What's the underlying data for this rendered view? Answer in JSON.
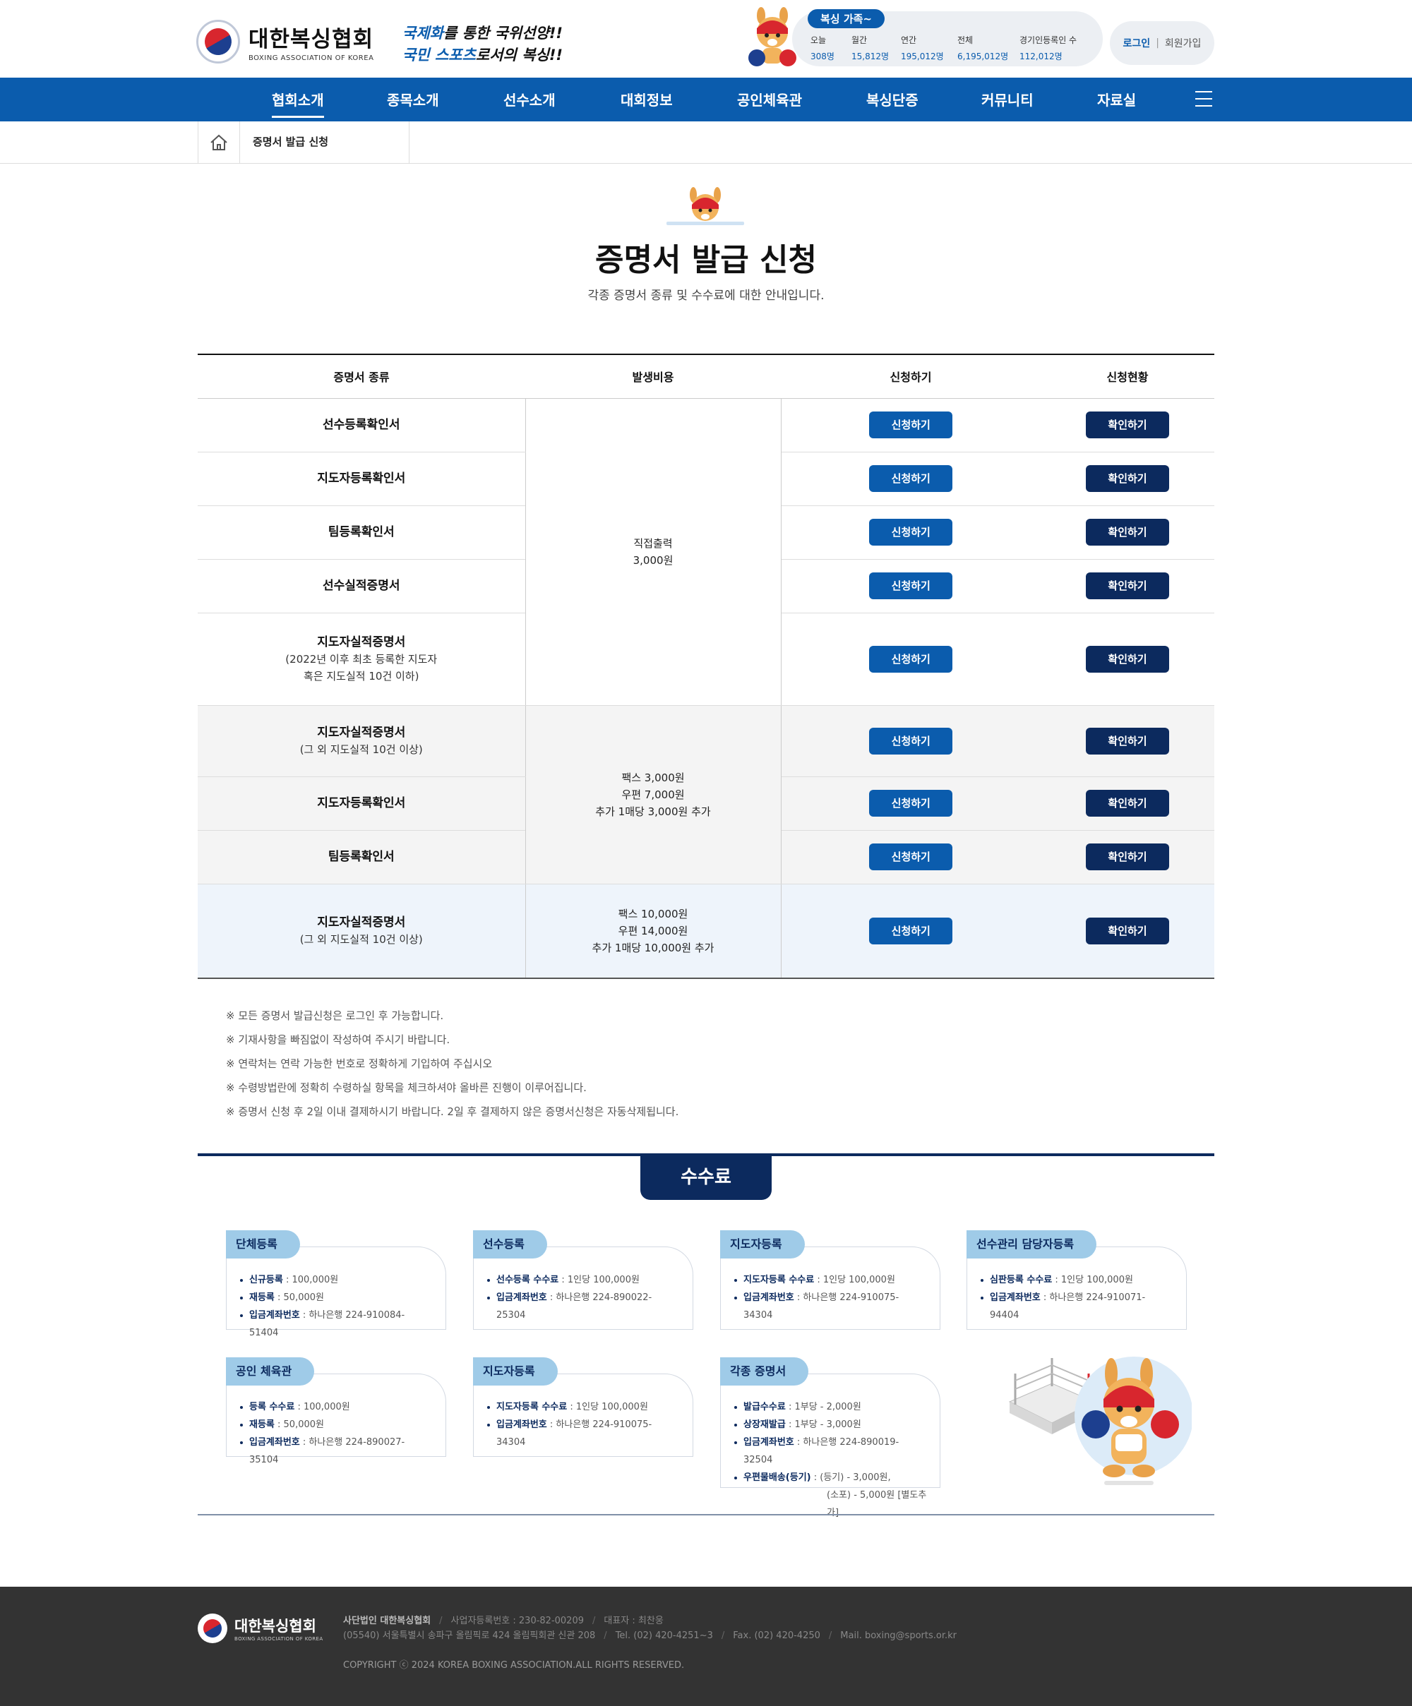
{
  "header": {
    "logo_kr": "대한복싱협회",
    "logo_en": "BOXING ASSOCIATION OF KOREA",
    "slogan_line1_hl": "국제화",
    "slogan_line1_rest": "를 통한 국위선양!!",
    "slogan_line2_hl": "국민 스포츠",
    "slogan_line2_rest": "로서의 복싱!!",
    "stats_badge": "복싱 가족~",
    "stats": [
      {
        "label": "오늘",
        "value": "308명"
      },
      {
        "label": "월간",
        "value": "15,812명"
      },
      {
        "label": "연간",
        "value": "195,012명"
      },
      {
        "label": "전체",
        "value": "6,195,012명"
      },
      {
        "label": "경기인등록인 수",
        "value": "112,012명"
      }
    ],
    "login": "로그인",
    "join": "회원가입"
  },
  "gnb": [
    "협회소개",
    "종목소개",
    "선수소개",
    "대회정보",
    "공인체육관",
    "복싱단증",
    "커뮤니티",
    "자료실"
  ],
  "breadcrumb": {
    "current": "증명서 발급 신청"
  },
  "page": {
    "title": "증명서 발급 신청",
    "subtitle": "각종 증명서 종류 및 수수료에 대한 안내입니다."
  },
  "table": {
    "headers": [
      "증명서 종류",
      "발생비용",
      "신청하기",
      "신청현황"
    ],
    "apply_label": "신청하기",
    "check_label": "확인하기",
    "group1": {
      "fee_lines": [
        "직접출력",
        "3,000원"
      ],
      "rows": [
        {
          "name": "선수등록확인서",
          "sub": []
        },
        {
          "name": "지도자등록확인서",
          "sub": []
        },
        {
          "name": "팀등록확인서",
          "sub": []
        },
        {
          "name": "선수실적증명서",
          "sub": []
        },
        {
          "name": "지도자실적증명서",
          "sub": [
            "(2022년 이후 최초 등록한 지도자",
            "혹은 지도실적 10건 이하)"
          ]
        }
      ]
    },
    "group2": {
      "fee_lines": [
        "팩스 3,000원",
        "우편 7,000원",
        "추가 1매당 3,000원 추가"
      ],
      "rows": [
        {
          "name": "지도자실적증명서",
          "sub": [
            "(그 외 지도실적 10건 이상)"
          ]
        },
        {
          "name": "지도자등록확인서",
          "sub": []
        },
        {
          "name": "팀등록확인서",
          "sub": []
        }
      ]
    },
    "group3": {
      "fee_lines": [
        "팩스 10,000원",
        "우편 14,000원",
        "추가 1매당 10,000원 추가"
      ],
      "rows": [
        {
          "name": "지도자실적증명서",
          "sub": [
            "(그 외 지도실적 10건 이상)"
          ]
        }
      ]
    }
  },
  "notes": [
    "※ 모든 증명서 발급신청은 로그인 후 가능합니다.",
    "※ 기재사항을 빠짐없이 작성하여 주시기 바랍니다.",
    "※ 연락처는 연락 가능한 번호로 정확하게 기입하여 주십시오",
    "※ 수령방법란에 정확히 수령하실 항목을 체크하셔야 올바른 진행이 이루어집니다.",
    "※ 증명서 신청 후 2일 이내 결제하시기 바랍니다. 2일 후 결제하지 않은 증명서신청은 자동삭제됩니다."
  ],
  "fees": {
    "tab": "수수료",
    "cards": [
      {
        "title": "단체등록",
        "items": [
          {
            "k": "신규등록",
            "v": " : 100,000원"
          },
          {
            "k": "재등록",
            "v": " : 50,000원"
          },
          {
            "k": "입금계좌번호",
            "v": " : 하나은행 224-910084-51404"
          }
        ]
      },
      {
        "title": "선수등록",
        "items": [
          {
            "k": "선수등록 수수료",
            "v": " : 1인당 100,000원"
          },
          {
            "k": "입금계좌번호",
            "v": " : 하나은행 224-890022-25304"
          }
        ]
      },
      {
        "title": "지도자등록",
        "items": [
          {
            "k": "지도자등록 수수료",
            "v": " : 1인당 100,000원"
          },
          {
            "k": "입금계좌번호",
            "v": " : 하나은행 224-910075-34304"
          }
        ]
      },
      {
        "title": "선수관리 담당자등록",
        "items": [
          {
            "k": "심판등록 수수료",
            "v": " : 1인당 100,000원"
          },
          {
            "k": "입금계좌번호",
            "v": " : 하나은행 224-910071-94404"
          }
        ]
      },
      {
        "title": "공인 체육관",
        "items": [
          {
            "k": "등록 수수료",
            "v": " : 100,000원"
          },
          {
            "k": "재등록",
            "v": " : 50,000원"
          },
          {
            "k": "입금계좌번호",
            "v": " : 하나은행 224-890027-35104"
          }
        ]
      },
      {
        "title": "지도자등록",
        "items": [
          {
            "k": "지도자등록 수수료",
            "v": " : 1인당 100,000원"
          },
          {
            "k": "입금계좌번호",
            "v": " : 하나은행 224-910075-34304"
          }
        ]
      },
      {
        "title": "각종 증명서",
        "items": [
          {
            "k": "발급수수료",
            "v": " : 1부당 - 2,000원"
          },
          {
            "k": "상장재발급",
            "v": " : 1부당 - 3,000원"
          },
          {
            "k": "입금계좌번호",
            "v": " : 하나은행 224-890019-32504"
          },
          {
            "k": "우편물배송(등기)",
            "v": " : (등기) - 3,000원,",
            "v2": "(소포) - 5,000원 [별도추가]"
          }
        ]
      }
    ]
  },
  "footer": {
    "logo_kr": "대한복싱협회",
    "logo_en": "BOXING ASSOCIATION OF KOREA",
    "org": "사단법인 대한복싱협회",
    "bizno": "사업자등록번호 : 230-82-00209",
    "ceo": "대표자 : 최찬웅",
    "addr": "(05540) 서울특별시 송파구 올림픽로 424 올림픽회관 신관 208",
    "tel": "Tel. (02) 420-4251~3",
    "fax": "Fax. (02) 420-4250",
    "mail": "Mail. boxing@sports.or.kr",
    "copyright": "COPYRIGHT ⓒ 2024 KOREA BOXING ASSOCIATION.ALL RIGHTS RESERVED."
  },
  "colors": {
    "primary": "#0b5cad",
    "navy": "#0c2a5e",
    "card_title": "#9fcbe8",
    "footer_bg": "#333333"
  },
  "icons": [
    "home-icon",
    "menu-icon",
    "kangaroo-mascot-icon",
    "boxing-ring-icon"
  ]
}
